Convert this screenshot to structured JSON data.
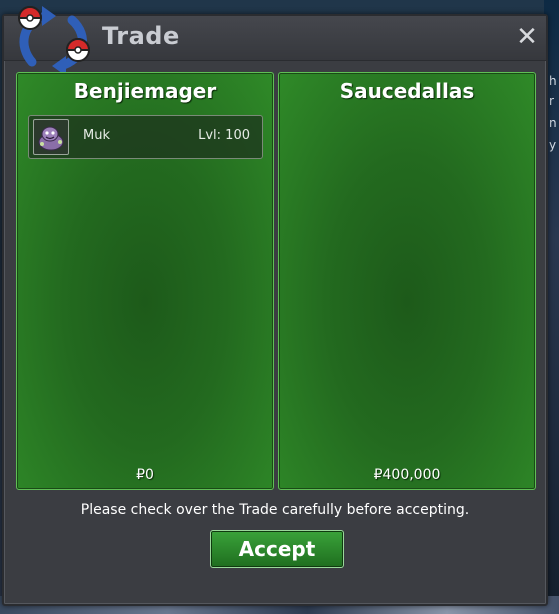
{
  "window": {
    "title": "Trade",
    "close_glyph": "✕"
  },
  "trade": {
    "left_player": {
      "name": "Benjiemager",
      "money": "₽0",
      "items": [
        {
          "name": "Muk",
          "level": "Lvl: 100",
          "icon": "muk-sprite-icon"
        }
      ]
    },
    "right_player": {
      "name": "Saucedallas",
      "money": "₽400,000",
      "items": []
    }
  },
  "notice": "Please check over the Trade carefully before accepting.",
  "accept_label": "Accept",
  "background_text": [
    "h",
    "r",
    "n",
    "y"
  ],
  "colors": {
    "panel_green": "#236a1f",
    "panel_border": "#5fbf55",
    "accept_green": "#2f8a2f",
    "window_gray": "#3b3d42"
  }
}
